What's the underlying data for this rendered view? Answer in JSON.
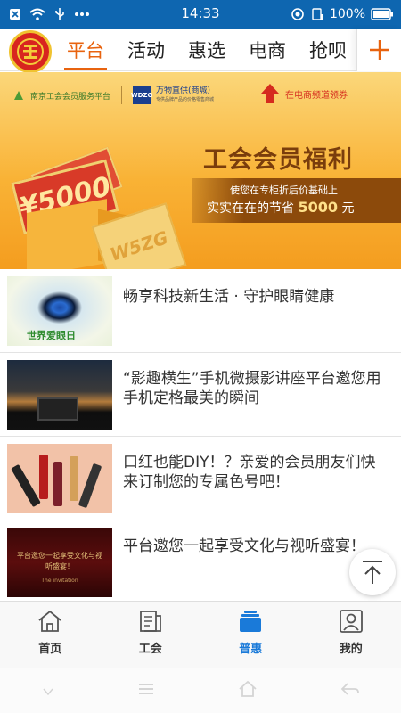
{
  "status_bar": {
    "time": "14:33",
    "battery": "100%",
    "icons": [
      "close-box-icon",
      "wifi-icon",
      "usb-icon",
      "more-dots-icon",
      "location-icon",
      "sim-icon",
      "battery-icon"
    ]
  },
  "top_nav": {
    "tabs": [
      {
        "label": "平台",
        "active": true
      },
      {
        "label": "活动",
        "active": false
      },
      {
        "label": "惠选",
        "active": false
      },
      {
        "label": "电商",
        "active": false
      },
      {
        "label": "抢呗",
        "active": false
      }
    ],
    "add_icon": "plus-icon",
    "accent_color": "#e8630f"
  },
  "banner": {
    "platform_text": "南京工会会员服务平台",
    "partner_logo": "WDZG",
    "partner_name": "万物直供(商城)",
    "partner_tagline": "专供品牌产品的价格零售商城",
    "coupon_text": "在电商频道领券",
    "title": "工会会员福利",
    "sub1": "使您在专柜折后价基础上",
    "sub2_prefix": "实实在在的节省",
    "sub2_amount": "5000",
    "sub2_suffix": "元",
    "card_text": "¥5000",
    "box_text": "W5ZG"
  },
  "news": [
    {
      "title": "畅享科技新生活 · 守护眼睛健康",
      "thumb_text": "世界爱眼日"
    },
    {
      "title": "“影趣横生”手机微摄影讲座平台邀您用手机定格最美的瞬间",
      "thumb_text": ""
    },
    {
      "title": "口红也能DIY！？亲爱的会员朋友们快来订制您的专属色号吧！",
      "thumb_text": ""
    },
    {
      "title": "平台邀您一起享受文化与视听盛宴！",
      "thumb_text": "平台邀您一起享受文化与视听盛宴！",
      "thumb_sub": "The invitation"
    }
  ],
  "bottom_tabs": [
    {
      "label": "首页",
      "icon": "home-icon",
      "active": false
    },
    {
      "label": "工会",
      "icon": "news-icon",
      "active": false
    },
    {
      "label": "普惠",
      "icon": "card-stack-icon",
      "active": true
    },
    {
      "label": "我的",
      "icon": "profile-icon",
      "active": false
    }
  ],
  "back_to_top_icon": "arrow-up-to-top-icon"
}
